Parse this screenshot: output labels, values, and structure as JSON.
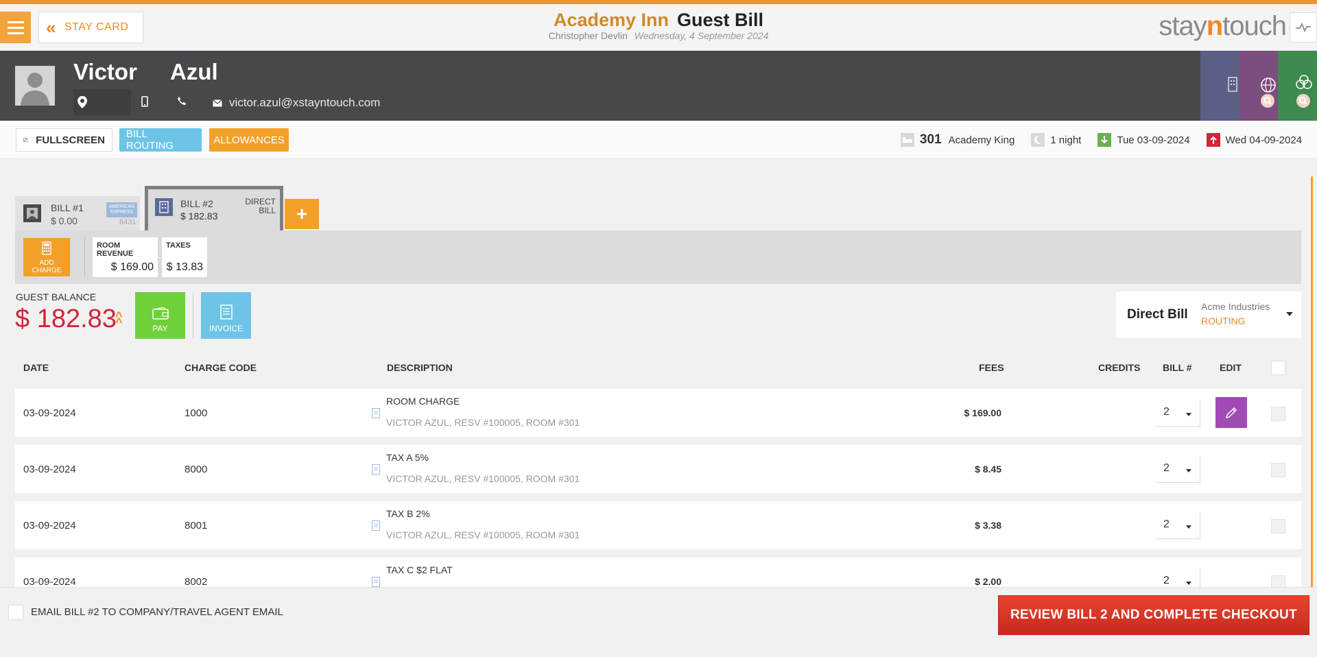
{
  "header": {
    "stay_card_label": "STAY CARD",
    "hotel_name": "Academy Inn",
    "page_title": "Guest Bill",
    "user_name": "Christopher Devlin",
    "business_date": "Wednesday, 4 September 2024",
    "logo_text_1": "stay",
    "logo_text_2": "n",
    "logo_text_3": "touch"
  },
  "guest": {
    "first_name": "Victor",
    "last_name": "Azul",
    "email": "victor.azul@xstayntouch.com"
  },
  "toolbar": {
    "fullscreen_label": "FULLSCREEN",
    "bill_routing_label": "BILL ROUTING",
    "allowances_label": "ALLOWANCES"
  },
  "stay": {
    "room_number": "301",
    "room_type": "Academy King",
    "nights": "1 night",
    "arrival": "Tue 03-09-2024",
    "departure": "Wed 04-09-2024"
  },
  "bills": [
    {
      "name": "BILL #1",
      "amount": "$ 0.00",
      "card_brand_1": "AMERICAN",
      "card_brand_2": "EXPRESS",
      "card_last4": "8431"
    },
    {
      "name": "BILL #2",
      "amount": "$ 182.83",
      "type_1": "DIRECT",
      "type_2": "BILL"
    }
  ],
  "add_bill_label": "+",
  "charge_strip": {
    "add_charge_1": "ADD",
    "add_charge_2": "CHARGE",
    "categories": [
      {
        "label": "ROOM REVENUE",
        "value": "$ 169.00"
      },
      {
        "label": "TAXES",
        "value": "$ 13.83"
      }
    ]
  },
  "balance": {
    "label": "GUEST BALANCE",
    "amount": "$ 182.83",
    "pay_label": "PAY",
    "invoice_label": "INVOICE"
  },
  "direct_bill": {
    "label": "Direct Bill",
    "company": "Acme Industries",
    "routing": "ROUTING"
  },
  "table": {
    "columns": {
      "date": "DATE",
      "charge_code": "CHARGE CODE",
      "description": "DESCRIPTION",
      "fees": "FEES",
      "credits": "CREDITS",
      "bill": "BILL #",
      "edit": "EDIT"
    },
    "rows": [
      {
        "date": "03-09-2024",
        "code": "1000",
        "desc": "ROOM CHARGE",
        "sub": "VICTOR AZUL, RESV #100005, ROOM #301",
        "fee": "$ 169.00",
        "bill": "2"
      },
      {
        "date": "03-09-2024",
        "code": "8000",
        "desc": "TAX A 5%",
        "sub": "VICTOR AZUL, RESV #100005, ROOM #301",
        "fee": "$ 8.45",
        "bill": "2"
      },
      {
        "date": "03-09-2024",
        "code": "8001",
        "desc": "TAX B 2%",
        "sub": "VICTOR AZUL, RESV #100005, ROOM #301",
        "fee": "$ 3.38",
        "bill": "2"
      },
      {
        "date": "03-09-2024",
        "code": "8002",
        "desc": "TAX C $2 FLAT",
        "sub": "",
        "fee": "$ 2.00",
        "bill": "2"
      }
    ]
  },
  "footer": {
    "email_label": "EMAIL BILL #2 TO COMPANY/TRAVEL AGENT EMAIL",
    "checkout_label": "REVIEW BILL 2 AND COMPLETE CHECKOUT"
  },
  "colors": {
    "accent_orange": "#f3a02a",
    "balance_red": "#d0253a",
    "band_dark": "#45494c",
    "edit_purple": "#a04ab6",
    "pay_green": "#6ed13a",
    "routing_blue": "#6ec4e6",
    "checkout_red": "#d8372a"
  }
}
